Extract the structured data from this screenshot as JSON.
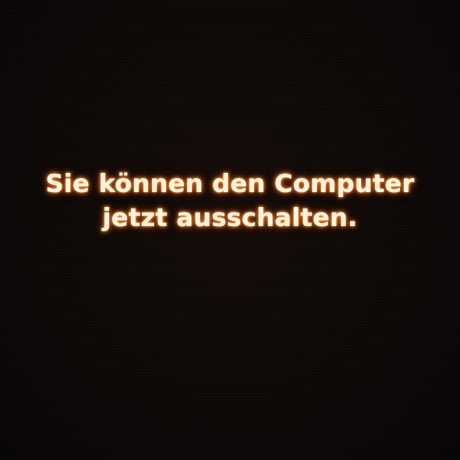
{
  "screen": {
    "message_line1": "Sie können den Computer",
    "message_line2": "jetzt ausschalten.",
    "background_color": "#0b0705",
    "text_color": "#fff3dc",
    "glow_color": "#e0601a"
  }
}
